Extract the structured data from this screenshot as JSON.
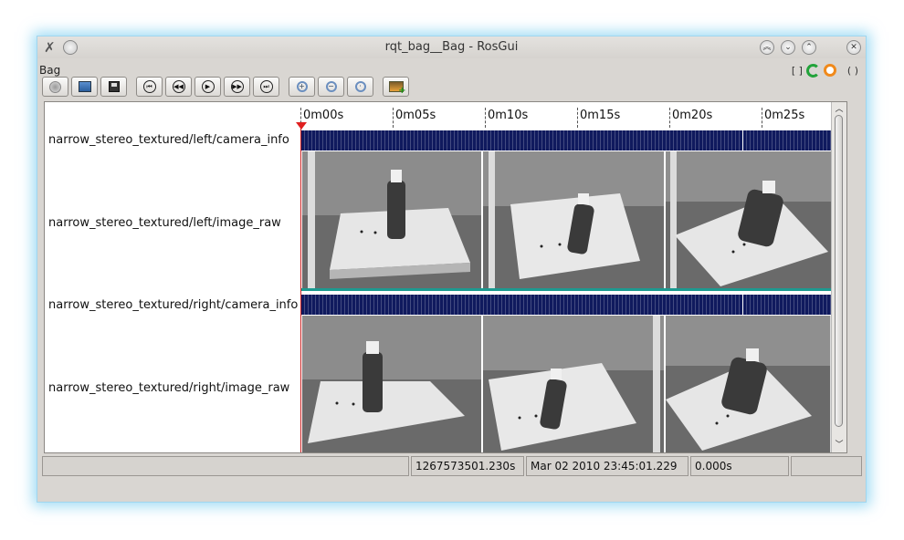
{
  "window": {
    "title": "rqt_bag__Bag - RosGui"
  },
  "plugin": {
    "title": "Bag",
    "ctrl_left": "[ ]",
    "ctrl_right": "( )"
  },
  "toolbar": {
    "buttons": [
      {
        "icon": "record-icon"
      },
      {
        "icon": "open-icon"
      },
      {
        "icon": "save-icon"
      },
      {
        "icon": "begin-icon"
      },
      {
        "icon": "rewind-icon"
      },
      {
        "icon": "play-icon"
      },
      {
        "icon": "fastforward-icon"
      },
      {
        "icon": "end-icon"
      },
      {
        "icon": "zoom-in-icon"
      },
      {
        "icon": "zoom-out-icon"
      },
      {
        "icon": "zoom-reset-icon"
      },
      {
        "icon": "thumbnails-icon"
      }
    ]
  },
  "timeline": {
    "ticks": [
      "0m00s",
      "0m05s",
      "0m10s",
      "0m15s",
      "0m20s",
      "0m25s"
    ],
    "topics": [
      "narrow_stereo_textured/left/camera_info",
      "narrow_stereo_textured/left/image_raw",
      "narrow_stereo_textured/right/camera_info",
      "narrow_stereo_textured/right/image_raw"
    ]
  },
  "status": {
    "stamp": "1267573501.230s",
    "date": "Mar 02 2010 23:45:01.229",
    "elapsed": "0.000s"
  },
  "colors": {
    "message_bar": "#101a5e",
    "playhead": "#e02020",
    "window_glow": "#50bee8"
  }
}
